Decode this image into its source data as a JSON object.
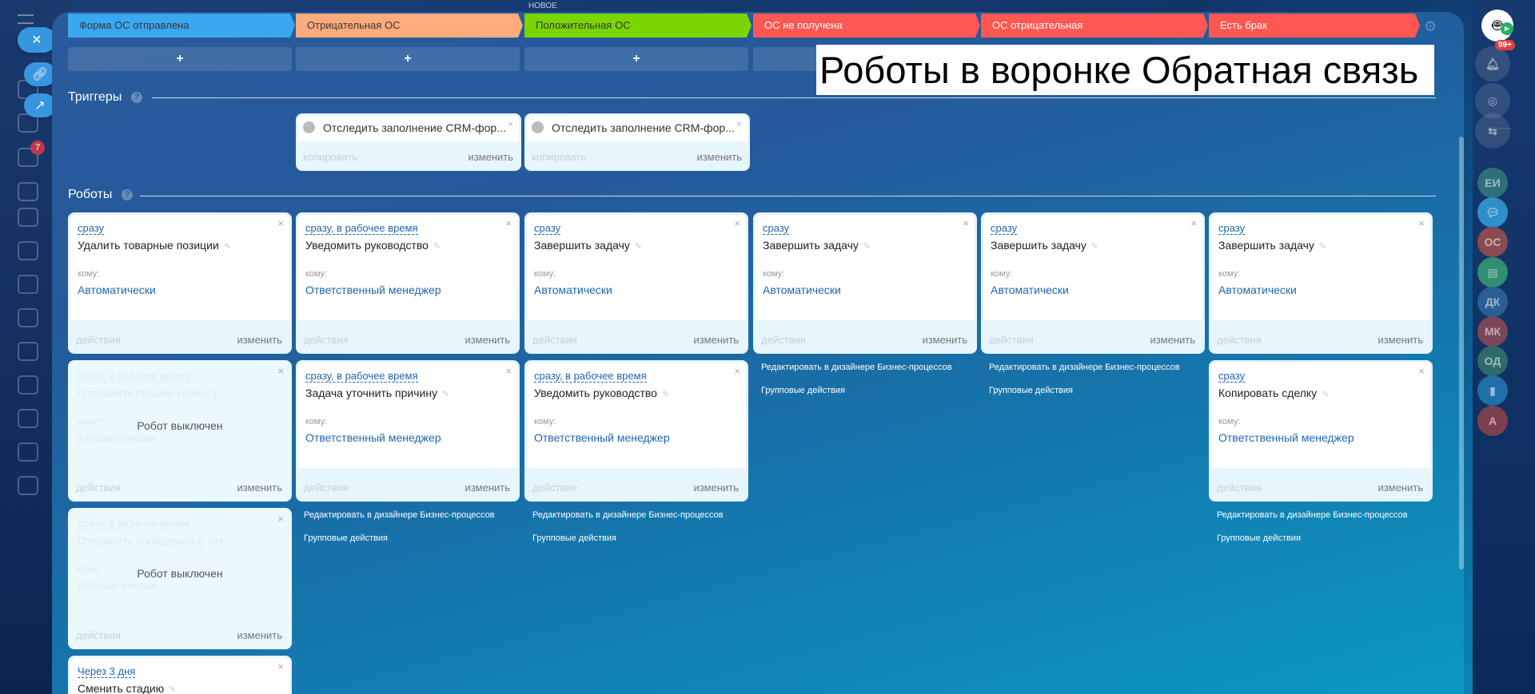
{
  "header": {
    "new_label": "НОВОЕ"
  },
  "overlay_title": "Роботы в воронке Обратная связь",
  "stages": [
    {
      "label": "Форма ОС отправлена",
      "color": "#3ba7ee",
      "text": "#33373d"
    },
    {
      "label": "Отрицательная ОС",
      "color": "#ffab7b",
      "text": "#33373d"
    },
    {
      "label": "Положительная ОС",
      "color": "#7bd500",
      "text": "#33373d"
    },
    {
      "label": "ОС не получена",
      "color": "#ff5752",
      "text": "#ffffff"
    },
    {
      "label": "ОС отрицательная",
      "color": "#ff5752",
      "text": "#ffffff"
    },
    {
      "label": "Есть брак",
      "color": "#ff5752",
      "text": "#ffffff"
    }
  ],
  "add_label": "+",
  "triggers_section": {
    "title": "Триггеры",
    "help": "?"
  },
  "robots_section": {
    "title": "Роботы",
    "help": "?"
  },
  "triggers": [
    {
      "column": 1,
      "title": "Отследить заполнение CRM-фор...",
      "copy": "копировать",
      "edit": "изменить"
    },
    {
      "column": 2,
      "title": "Отследить заполнение CRM-фор...",
      "copy": "копировать",
      "edit": "изменить"
    }
  ],
  "card_labels": {
    "to": "кому:",
    "actions": "действия",
    "edit": "изменить",
    "disabled": "Робот выключен",
    "close": "×"
  },
  "column_links": {
    "designer": "Редактировать в дизайнере Бизнес-процессов",
    "group": "Групповые действия"
  },
  "columns": [
    {
      "robots": [
        {
          "timing": "сразу",
          "title": "Удалить товарные позиции",
          "to": "Автоматически"
        },
        {
          "timing": "сразу, в рабочее время",
          "title": "Отправить письмо клиенту",
          "to": "Автоматически",
          "disabled": true
        },
        {
          "timing": "сразу, в рабочее время",
          "title": "Отправить сообщение в чат",
          "to": "Автоматически",
          "disabled": true
        },
        {
          "timing": "Через 3 дня",
          "title": "Сменить стадию"
        }
      ],
      "links": false
    },
    {
      "robots": [
        {
          "timing": "сразу, в рабочее время",
          "title": "Уведомить руководство",
          "to": "Ответственный менеджер"
        },
        {
          "timing": "сразу, в рабочее время",
          "title": "Задача уточнить причину",
          "to": "Ответственный менеджер"
        }
      ],
      "links": true
    },
    {
      "robots": [
        {
          "timing": "сразу",
          "title": "Завершить задачу",
          "to": "Автоматически"
        },
        {
          "timing": "сразу, в рабочее время",
          "title": "Уведомить руководство",
          "to": "Ответственный менеджер"
        }
      ],
      "links": true
    },
    {
      "robots": [
        {
          "timing": "сразу",
          "title": "Завершить задачу",
          "to": "Автоматически"
        }
      ],
      "links": true
    },
    {
      "robots": [
        {
          "timing": "сразу",
          "title": "Завершить задачу",
          "to": "Автоматически"
        }
      ],
      "links": true
    },
    {
      "robots": [
        {
          "timing": "сразу",
          "title": "Завершить задачу",
          "to": "Автоматически"
        },
        {
          "timing": "сразу",
          "title": "Копировать сделку",
          "to": "Ответственный менеджер"
        }
      ],
      "links": true
    }
  ],
  "left_sidebar": {
    "tasks_badge": "7"
  },
  "right_sidebar": {
    "notifications_badge": "99+",
    "avatars": [
      {
        "initials": "ЕИ",
        "color": "#2f6f7a"
      },
      {
        "initials": "",
        "color": "#2f8fc8",
        "icon": "chat-icon"
      },
      {
        "initials": "ОС",
        "color": "#8a4a50"
      },
      {
        "initials": "",
        "color": "#2f8f70",
        "icon": "news-icon"
      },
      {
        "initials": "ДК",
        "color": "#2a5f95"
      },
      {
        "initials": "МК",
        "color": "#7a4658"
      },
      {
        "initials": "ОД",
        "color": "#2f6a6a"
      },
      {
        "initials": "",
        "color": "#1f6fa8",
        "icon": "bookmark-icon"
      },
      {
        "initials": "А",
        "color": "#7a4050"
      }
    ]
  }
}
